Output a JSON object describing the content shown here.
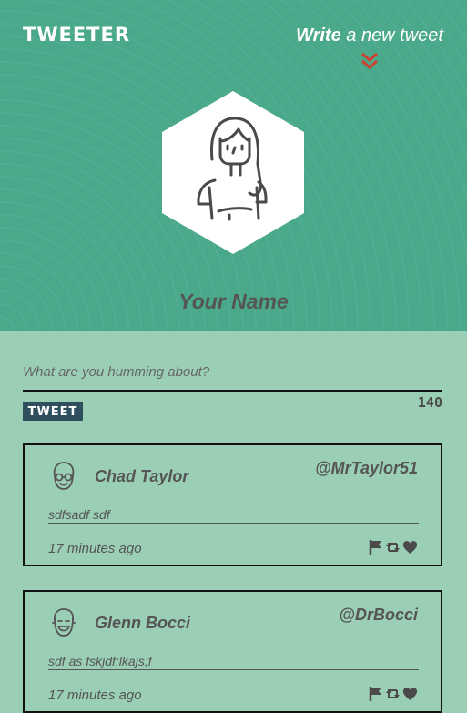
{
  "header": {
    "brand": "TWEETER",
    "compose_bold": "Write",
    "compose_rest": " a new tweet",
    "profile_name": "Your Name"
  },
  "composer": {
    "placeholder": "What are you humming about?",
    "char_count": "140",
    "tweet_button": "TWEET"
  },
  "tweets": [
    {
      "name": "Chad Taylor",
      "handle": "@MrTaylor51",
      "text": "sdfsadf sdf",
      "time": "17 minutes ago"
    },
    {
      "name": "Glenn Bocci",
      "handle": "@DrBocci",
      "text": "sdf as fskjdf;lkajs;f",
      "time": "17 minutes ago"
    }
  ],
  "colors": {
    "header_bg": "#4aa88b",
    "page_bg": "#9acfb5",
    "accent_red": "#d0402e",
    "button_bg": "#2f4f5f"
  },
  "icons": [
    "chevron-double-down-icon",
    "avatar-illustration",
    "flag-icon",
    "retweet-icon",
    "heart-icon"
  ]
}
